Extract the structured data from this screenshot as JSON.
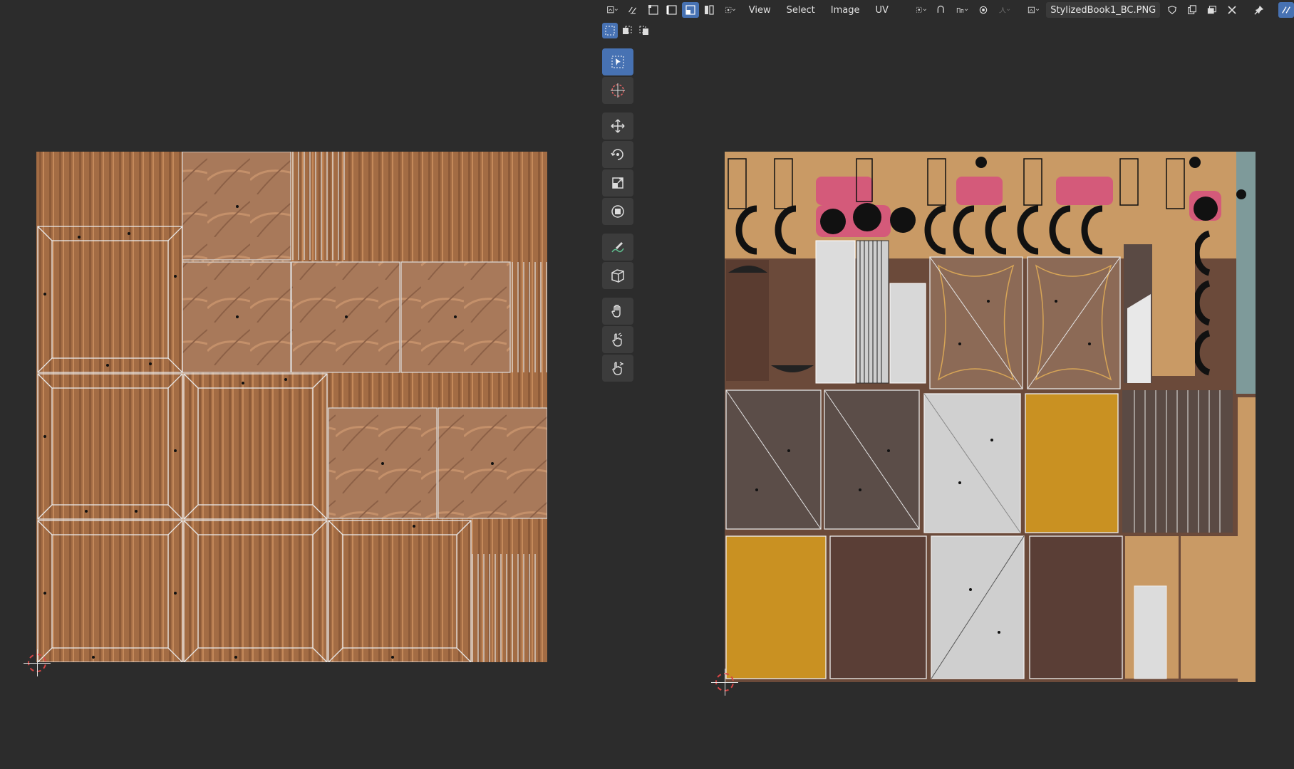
{
  "header": {
    "menus": [
      "View",
      "Select",
      "Image",
      "UV"
    ],
    "image_name": "StylizedBook1_BC.PNG"
  },
  "tools": [
    {
      "name": "select-box-icon",
      "active": true
    },
    {
      "name": "cursor-icon",
      "active": false
    },
    {
      "name": "move-icon",
      "active": false
    },
    {
      "name": "rotate-icon",
      "active": false
    },
    {
      "name": "scale-icon",
      "active": false
    },
    {
      "name": "transform-icon",
      "active": false
    },
    {
      "name": "annotate-icon",
      "active": false
    },
    {
      "name": "rip-region-icon",
      "active": false
    },
    {
      "name": "grab-icon",
      "active": false
    },
    {
      "name": "relax-icon",
      "active": false
    },
    {
      "name": "pinch-icon",
      "active": false
    }
  ],
  "colors": {
    "accent": "#4772b3",
    "background": "#2c2c2c",
    "wood": "#9c6a42",
    "leather": "#b0856a",
    "gold": "#c8962e",
    "paper": "#c9c9c9",
    "dark_leather": "#5a4a44"
  }
}
